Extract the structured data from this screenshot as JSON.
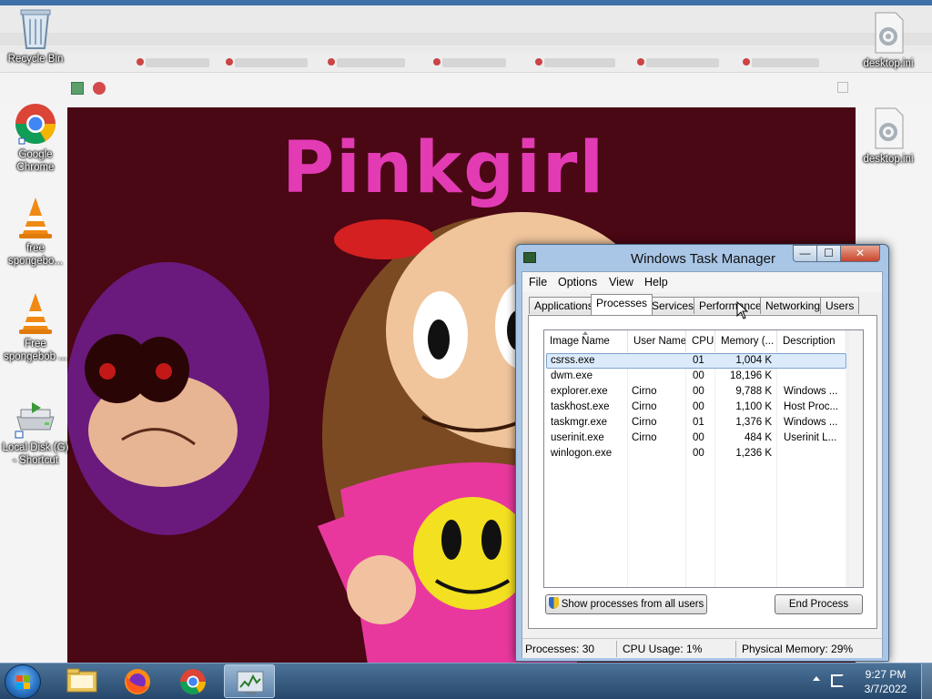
{
  "desktop": {
    "icons": [
      {
        "label": "Recycle Bin",
        "icon": "recycle-bin-icon"
      },
      {
        "label": "Google Chrome",
        "icon": "chrome-icon"
      },
      {
        "label": "free spongebo...",
        "icon": "vlc-icon"
      },
      {
        "label": "Free spongebob ...",
        "icon": "vlc-icon"
      },
      {
        "label": "Local Disk (G) - Shortcut",
        "icon": "drive-shortcut-icon"
      },
      {
        "label": "desktop.ini",
        "icon": "settings-file-icon"
      },
      {
        "label": "desktop.ini",
        "icon": "settings-file-icon"
      }
    ]
  },
  "webpage": {
    "title": "Pinkgirl",
    "colors": {
      "background": "#4a0714",
      "title": "#e23bb4",
      "shirt": "#e8389e",
      "smiley": "#f3e021"
    }
  },
  "task_manager": {
    "title": "Windows Task Manager",
    "caption_buttons": {
      "minimize": "—",
      "maximize": "☐",
      "close": "✕"
    },
    "menu": [
      "File",
      "Options",
      "View",
      "Help"
    ],
    "tabs": [
      "Applications",
      "Processes",
      "Services",
      "Performance",
      "Networking",
      "Users"
    ],
    "active_tab": "Processes",
    "columns": [
      "Image Name",
      "User Name",
      "CPU",
      "Memory (...",
      "Description"
    ],
    "sorted_column": "Image Name",
    "rows": [
      {
        "image": "csrss.exe",
        "user": "",
        "cpu": "01",
        "memory": "1,004 K",
        "description": ""
      },
      {
        "image": "dwm.exe",
        "user": "",
        "cpu": "00",
        "memory": "18,196 K",
        "description": ""
      },
      {
        "image": "explorer.exe",
        "user": "Cirno",
        "cpu": "00",
        "memory": "9,788 K",
        "description": "Windows ..."
      },
      {
        "image": "taskhost.exe",
        "user": "Cirno",
        "cpu": "00",
        "memory": "1,100 K",
        "description": "Host Proc..."
      },
      {
        "image": "taskmgr.exe",
        "user": "Cirno",
        "cpu": "01",
        "memory": "1,376 K",
        "description": "Windows ..."
      },
      {
        "image": "userinit.exe",
        "user": "Cirno",
        "cpu": "00",
        "memory": "484 K",
        "description": "Userinit L..."
      },
      {
        "image": "winlogon.exe",
        "user": "",
        "cpu": "00",
        "memory": "1,236 K",
        "description": ""
      }
    ],
    "selected_row": "csrss.exe",
    "buttons": {
      "show_all": "Show processes from all users",
      "end_process": "End Process"
    },
    "status": {
      "processes": "Processes: 30",
      "cpu": "CPU Usage: 1%",
      "memory": "Physical Memory: 29%"
    }
  },
  "taskbar": {
    "pinned": [
      {
        "name": "windows-explorer",
        "icon": "folder-icon"
      },
      {
        "name": "firefox",
        "icon": "firefox-icon"
      },
      {
        "name": "chrome",
        "icon": "chrome-icon"
      },
      {
        "name": "task-manager",
        "icon": "task-manager-icon",
        "active": true
      }
    ],
    "clock": {
      "time": "9:27 PM",
      "date": "3/7/2022"
    }
  }
}
